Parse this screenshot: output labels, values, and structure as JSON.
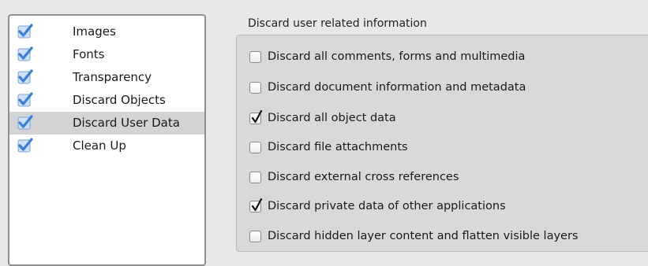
{
  "sidebar": {
    "items": [
      {
        "label": "Images",
        "checked": true,
        "selected": false
      },
      {
        "label": "Fonts",
        "checked": true,
        "selected": false
      },
      {
        "label": "Transparency",
        "checked": true,
        "selected": false
      },
      {
        "label": "Discard Objects",
        "checked": true,
        "selected": false
      },
      {
        "label": "Discard User Data",
        "checked": true,
        "selected": true
      },
      {
        "label": "Clean Up",
        "checked": true,
        "selected": false
      }
    ]
  },
  "group": {
    "title": "Discard user related information",
    "options": [
      {
        "label": "Discard all comments, forms and multimedia",
        "checked": false
      },
      {
        "label": "Discard document information and metadata",
        "checked": false
      },
      {
        "label": "Discard all object data",
        "checked": true
      },
      {
        "label": "Discard file attachments",
        "checked": false
      },
      {
        "label": "Discard external cross references",
        "checked": false
      },
      {
        "label": "Discard private data of other applications",
        "checked": true
      },
      {
        "label": "Discard hidden layer content and flatten visible layers",
        "checked": false
      }
    ]
  },
  "colors": {
    "sidebar_check": "#3b7fd6",
    "selected_row": "#d4d4d4",
    "panel_background": "#d9d9d9"
  },
  "icons": {
    "sidebar_check": "blue-checkmark-icon",
    "option_check": "checkmark-icon"
  }
}
